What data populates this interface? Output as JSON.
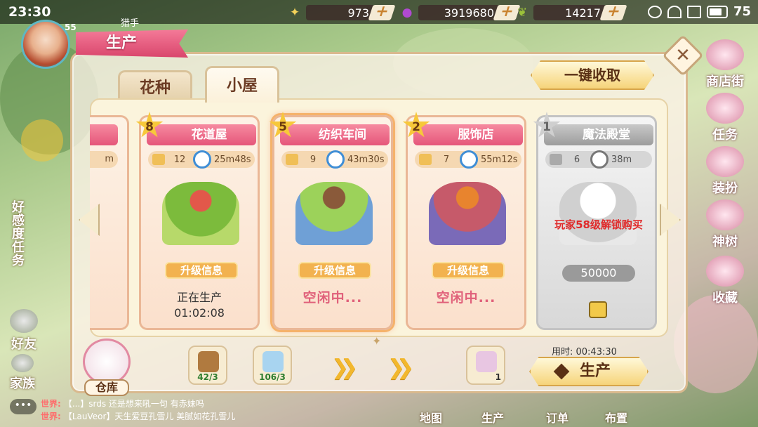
{
  "status_bar": {
    "time": "23:30",
    "battery": "75"
  },
  "currency": [
    {
      "icon": "star-icon",
      "value": "973"
    },
    {
      "icon": "berry-icon",
      "value": "3919680"
    },
    {
      "icon": "leaf-icon",
      "value": "14217"
    }
  ],
  "player": {
    "level": "55",
    "name": "猎手"
  },
  "panel": {
    "title": "生产",
    "tabs": [
      "花种",
      "小屋"
    ],
    "active_tab": "小屋",
    "harvest_all": "一键收取",
    "close": "✕"
  },
  "cards": [
    {
      "level": "8",
      "name": "花道屋",
      "count": "12",
      "time": "25m48s",
      "upgrade": "升级信息",
      "status": "正在生产",
      "status_time": "01:02:08"
    },
    {
      "level": "5",
      "name": "纺织车间",
      "count": "9",
      "time": "43m30s",
      "upgrade": "升级信息",
      "status": "空闲中..."
    },
    {
      "level": "2",
      "name": "服饰店",
      "count": "7",
      "time": "55m12s",
      "upgrade": "升级信息",
      "status": "空闲中..."
    },
    {
      "level": "1",
      "name": "魔法殿堂",
      "count": "6",
      "time": "38m",
      "lock_message": "玩家58级解锁购买",
      "cost": "50000"
    }
  ],
  "partial_card": {
    "time_suffix": "m"
  },
  "bottom": {
    "warehouse": "仓库",
    "materials": [
      {
        "name": "sack-icon",
        "count": "42/3"
      },
      {
        "name": "crystal-icon",
        "count": "106/3"
      },
      {
        "name": "fabric-icon",
        "count": "1"
      }
    ],
    "elapsed": "用时: 00:43:30",
    "produce": "生产"
  },
  "left_nav": {
    "quest": "好感度任务",
    "friends": "好友",
    "family": "家族"
  },
  "right_nav": [
    "商店街",
    "任务",
    "装扮",
    "神树",
    "收藏"
  ],
  "chat": [
    {
      "channel": "世界:",
      "text": "【...】srds 还是想来吼一句 有赤妹吗"
    },
    {
      "channel": "世界:",
      "text": "【LauVeor】天生爱豆孔雪儿 美腻如花孔雪儿"
    }
  ],
  "bottom_menu": [
    "地图",
    "生产",
    "订单",
    "布置"
  ],
  "colors": {
    "accent_pink": "#e5567a",
    "gold": "#f2b24f",
    "lock_red": "#e02a2a"
  }
}
